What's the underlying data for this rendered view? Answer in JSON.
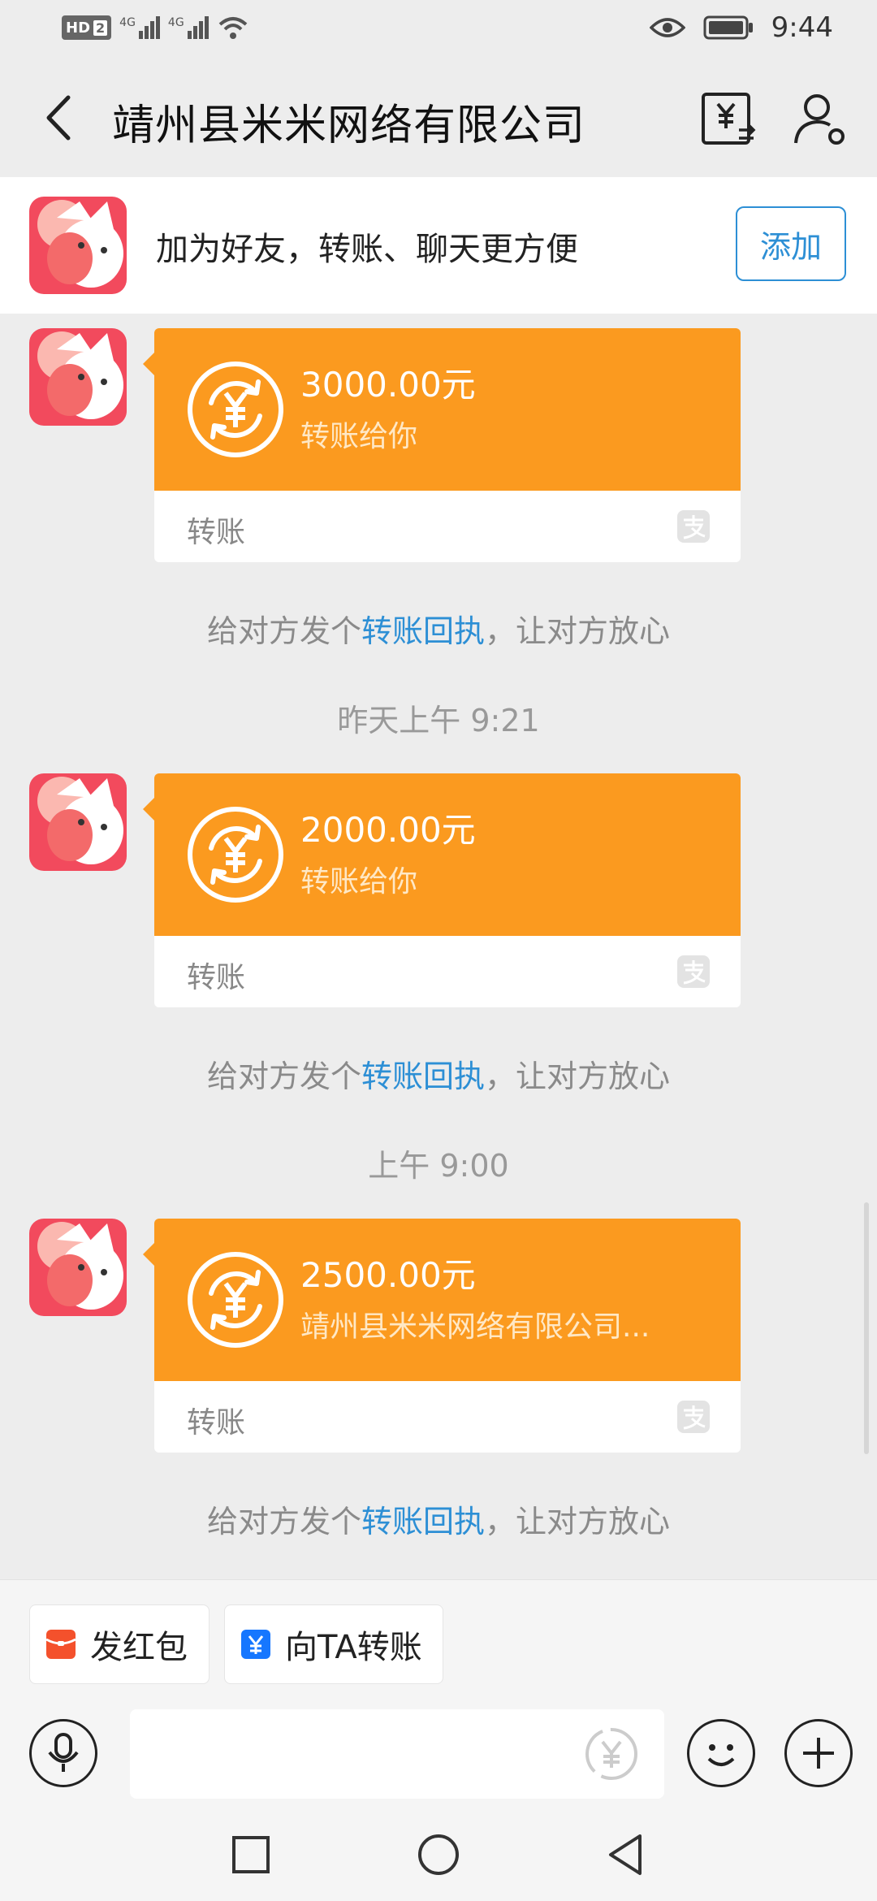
{
  "status_bar": {
    "hd": "HD",
    "hd_num": "2",
    "net1": "4G",
    "net2": "4G",
    "time": "9:44"
  },
  "header": {
    "title": "靖州县米米网络有限公司"
  },
  "friend_banner": {
    "text": "加为好友，转账、聊天更方便",
    "add_label": "添加"
  },
  "messages": [
    {
      "amount": "3000.00元",
      "desc": "转账给你",
      "type": "转账"
    },
    {
      "amount": "2000.00元",
      "desc": "转账给你",
      "type": "转账"
    },
    {
      "amount": "2500.00元",
      "desc": "靖州县米米网络有限公司...",
      "type": "转账"
    }
  ],
  "receipt": {
    "prefix": "给对方发个",
    "link": "转账回执",
    "suffix": "，让对方放心"
  },
  "timestamps": [
    "昨天上午 9:21",
    "上午 9:00"
  ],
  "quick_actions": {
    "red_packet": "发红包",
    "transfer": "向TA转账"
  },
  "colors": {
    "card_orange": "#fb9a1f",
    "link_blue": "#2d8fd5"
  }
}
